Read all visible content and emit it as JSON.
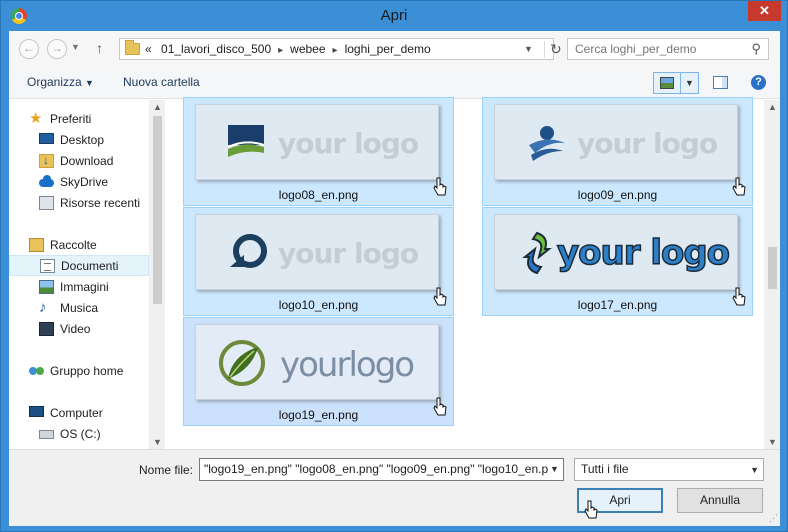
{
  "window": {
    "title": "Apri"
  },
  "controls": {
    "close_glyph": "✕"
  },
  "address": {
    "prefix": "«",
    "crumbs": [
      "01_lavori_disco_500",
      "webee",
      "loghi_per_demo"
    ],
    "search_placeholder": "Cerca loghi_per_demo"
  },
  "toolbar": {
    "organize": "Organizza",
    "new_folder": "Nuova cartella"
  },
  "sidebar": {
    "favorites": "Preferiti",
    "favorite_items": [
      "Desktop",
      "Download",
      "SkyDrive",
      "Risorse recenti"
    ],
    "libraries": "Raccolte",
    "library_items": [
      "Documenti",
      "Immagini",
      "Musica",
      "Video"
    ],
    "selected_item": "Documenti",
    "homegroup": "Gruppo home",
    "computer": "Computer",
    "computer_items": [
      "OS (C:)"
    ]
  },
  "files": [
    {
      "name": "logo08_en.png",
      "word": "your logo",
      "style": "faded"
    },
    {
      "name": "logo09_en.png",
      "word": "your logo",
      "style": "faded"
    },
    {
      "name": "logo10_en.png",
      "word": "your logo",
      "style": "faded"
    },
    {
      "name": "logo17_en.png",
      "word": "your logo",
      "style": "bold"
    },
    {
      "name": "logo19_en.png",
      "word": "yourlogo",
      "style": "leaf"
    }
  ],
  "footer": {
    "filename_label": "Nome file:",
    "filename_value": "\"logo19_en.png\" \"logo08_en.png\" \"logo09_en.png\" \"logo10_en.p",
    "filter_value": "Tutti i file",
    "open_label": "Apri",
    "cancel_label": "Annulla"
  },
  "colors": {
    "selection_fill": "#cce8ff",
    "selection_border": "#99d1ff",
    "title_bar": "#3a8fd6",
    "close_button": "#c7392c"
  }
}
